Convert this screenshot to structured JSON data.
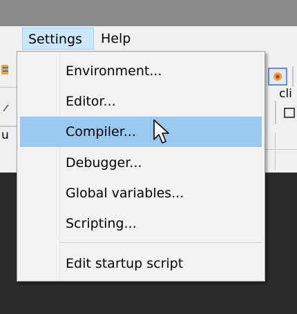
{
  "menubar": {
    "settings_label": "Settings",
    "help_label": "Help"
  },
  "settings_menu": {
    "items": [
      {
        "label": "Environment..."
      },
      {
        "label": "Editor..."
      },
      {
        "label": "Compiler..."
      },
      {
        "label": "Debugger..."
      },
      {
        "label": "Global variables..."
      },
      {
        "label": "Scripting..."
      },
      {
        "label": "Edit startup script"
      }
    ],
    "highlighted_item": "Compiler..."
  },
  "background": {
    "right_tab_text": "cli",
    "left_tab_text": "u"
  },
  "colors": {
    "highlight": "#99c9ef",
    "menubar_active": "#cce8ff",
    "dark_background": "#2b2b2b"
  }
}
